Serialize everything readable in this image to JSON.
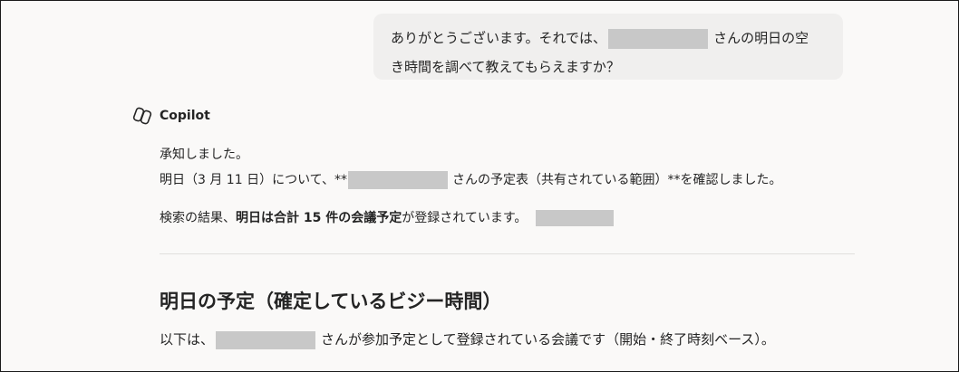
{
  "user_message": {
    "part1": "ありがとうございます。それでは、",
    "part2": "さんの明日の空",
    "part3": "き時間を調べて教えてもらえますか？"
  },
  "assistant": {
    "name": "Copilot",
    "logo_icon": "copilot-logo-icon",
    "line1": "承知しました。",
    "line2_a": "明日（3 月 11 日）について、**",
    "line2_b": "さんの予定表（共有されている範囲）**を確認しました。",
    "line3_a": "検索の結果、",
    "line3_bold": "明日は合計 15 件の会議予定",
    "line3_b": "が登録されています。",
    "heading": "明日の予定（確定しているビジー時間）",
    "line4_a": "以下は、",
    "line4_b": "さんが参加予定として登録されている会議です（開始・終了時刻ベース）。"
  },
  "colors": {
    "background": "#faf9f8",
    "bubble": "#f0efee",
    "redaction": "#c8c8c8",
    "divider": "#e1dfdd"
  }
}
